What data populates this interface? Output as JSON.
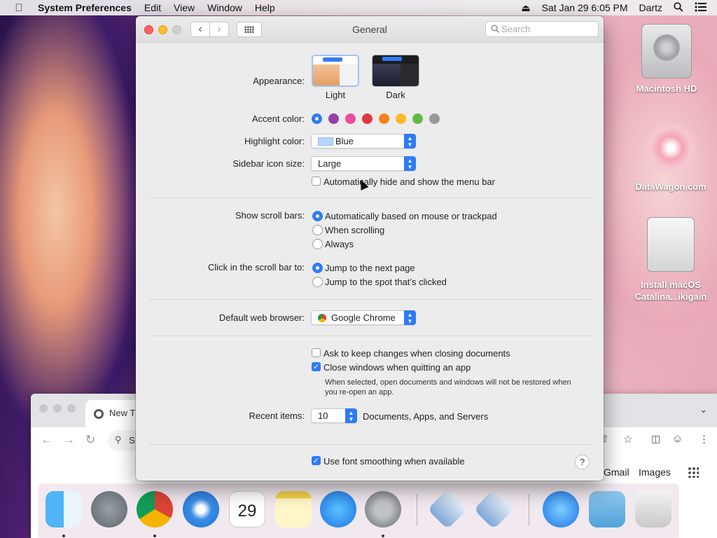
{
  "menubar": {
    "app_name": "System Preferences",
    "menus": [
      "Edit",
      "View",
      "Window",
      "Help"
    ],
    "datetime": "Sat Jan 29  6:05 PM",
    "user": "Dartz"
  },
  "desktop": {
    "icons": [
      {
        "label": "Macintosh HD"
      },
      {
        "label": "DataWagon.com"
      },
      {
        "label": "Install macOS Catalina...ikigain"
      }
    ]
  },
  "chrome": {
    "tab_title": "New T",
    "omnibox_text": "S",
    "links": [
      "Gmail",
      "Images"
    ]
  },
  "window": {
    "title": "General",
    "search_placeholder": "Search",
    "appearance": {
      "label": "Appearance:",
      "options": [
        "Light",
        "Dark"
      ],
      "selected": "Light"
    },
    "accent_color": {
      "label": "Accent color:",
      "colors": [
        "#2f7bf6",
        "#953fa8",
        "#ec4b9c",
        "#e0383e",
        "#f7821b",
        "#fcb827",
        "#62ba46",
        "#989898"
      ],
      "selected_index": 0
    },
    "highlight_color": {
      "label": "Highlight color:",
      "value": "Blue",
      "swatch": "#b3d7ff"
    },
    "sidebar_icon_size": {
      "label": "Sidebar icon size:",
      "value": "Large"
    },
    "auto_hide_menu_bar": {
      "label": "Automatically hide and show the menu bar",
      "checked": false
    },
    "show_scroll_bars": {
      "label": "Show scroll bars:",
      "options": [
        "Automatically based on mouse or trackpad",
        "When scrolling",
        "Always"
      ],
      "selected_index": 0
    },
    "click_scroll_bar": {
      "label": "Click in the scroll bar to:",
      "options": [
        "Jump to the next page",
        "Jump to the spot that’s clicked"
      ],
      "selected_index": 0
    },
    "default_browser": {
      "label": "Default web browser:",
      "value": "Google Chrome"
    },
    "ask_keep_changes": {
      "label": "Ask to keep changes when closing documents",
      "checked": false
    },
    "close_windows": {
      "label": "Close windows when quitting an app",
      "checked": true
    },
    "close_windows_note": "When selected, open documents and windows will not be restored when you re-open an app.",
    "recent_items": {
      "label": "Recent items:",
      "value": "10",
      "suffix": "Documents, Apps, and Servers"
    },
    "font_smoothing": {
      "label": "Use font smoothing when available",
      "checked": true
    },
    "help": "?"
  }
}
